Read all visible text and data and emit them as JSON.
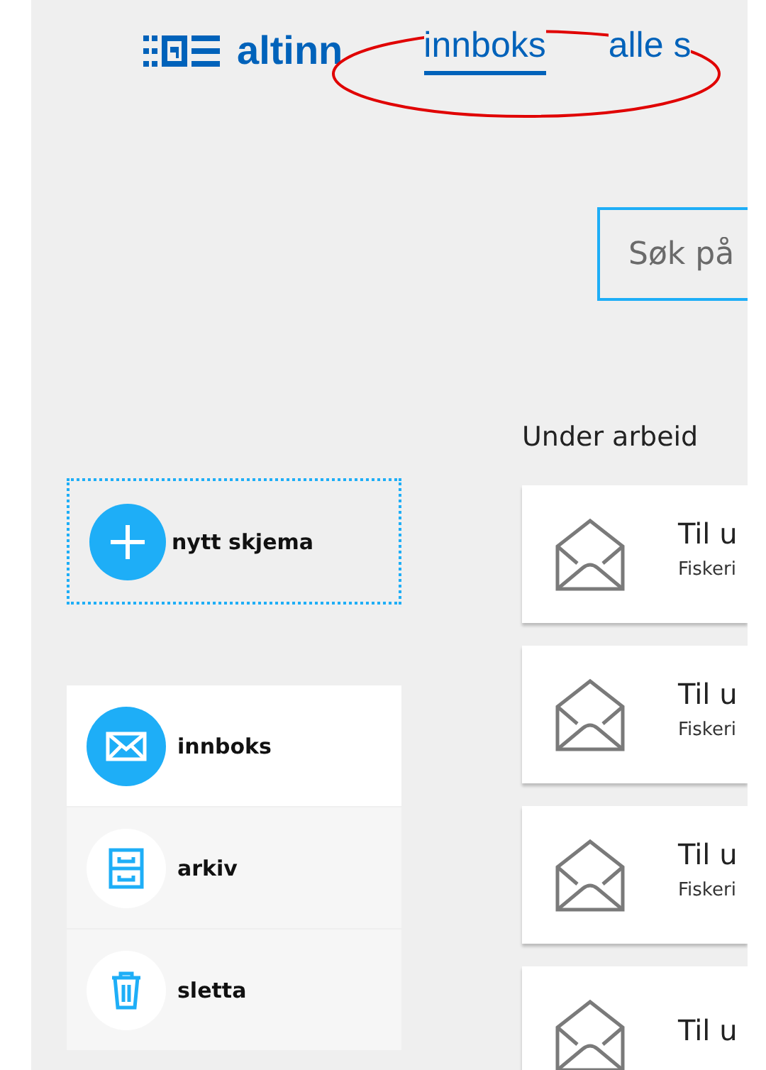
{
  "header": {
    "logo": "altinn",
    "nav": [
      {
        "label": "innboks",
        "selected": true
      },
      {
        "label": "alle s",
        "selected": false
      }
    ]
  },
  "search": {
    "placeholder": "Søk på"
  },
  "new_form": {
    "label": "nytt skjema"
  },
  "sidebar": {
    "items": [
      {
        "label": "innboks",
        "selected": true,
        "kind": "inbox"
      },
      {
        "label": "arkiv",
        "selected": false,
        "kind": "archive"
      },
      {
        "label": "sletta",
        "selected": false,
        "kind": "trash"
      }
    ]
  },
  "section": {
    "title": "Under arbeid"
  },
  "messages": [
    {
      "title": "Til u",
      "sender": "Fiskeri"
    },
    {
      "title": "Til u",
      "sender": "Fiskeri"
    },
    {
      "title": "Til u",
      "sender": "Fiskeri"
    },
    {
      "title": "Til u"
    }
  ]
}
